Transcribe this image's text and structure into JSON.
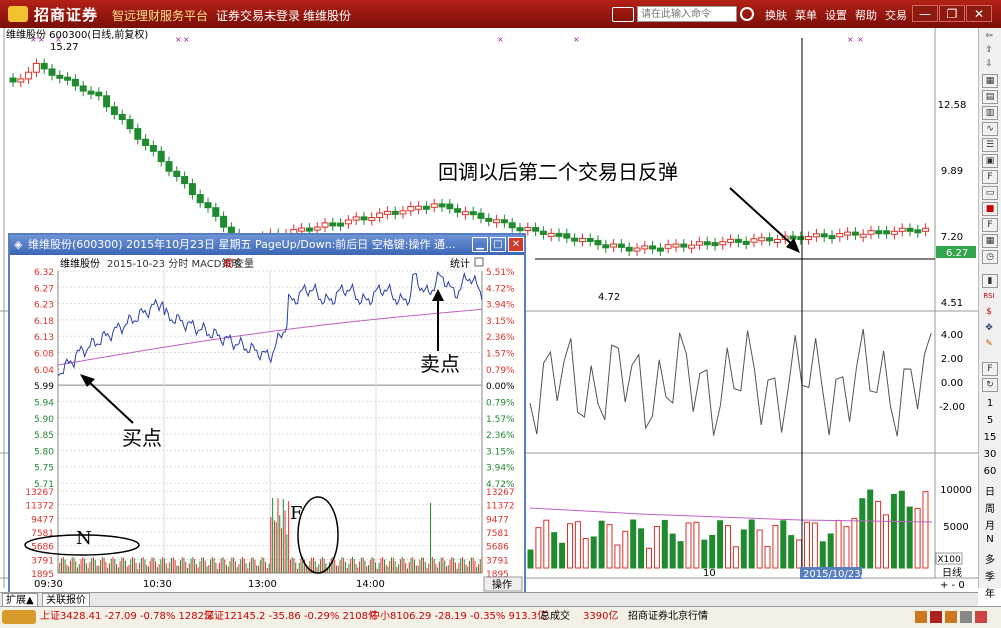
{
  "titlebar": {
    "brand": "招商证券",
    "slogan": "智远理财服务平台",
    "menu": [
      "证券交易未登录",
      "维维股份"
    ],
    "command_placeholder": "请在此输入命令",
    "right_menu": [
      "换肤",
      "菜单",
      "设置",
      "帮助",
      "交易"
    ],
    "window_buttons": [
      "—",
      "❐",
      "✕"
    ]
  },
  "main": {
    "header": "维维股份 600300(日线,前复权)",
    "high_label": "15.27",
    "low_label": "4.72",
    "price_ticks": [
      "12.58",
      "9.89",
      "7.20",
      "4.51"
    ],
    "current_price": "6.27",
    "osc_ticks": [
      "4.00",
      "2.00",
      "0.00",
      "-2.00"
    ],
    "vol_ticks": [
      "10000",
      "5000"
    ],
    "vol_unit": "X100",
    "x_label": "10",
    "date_label": "2015/10/23/五",
    "period_label": "日线",
    "annotation": "回调以后第二个交易日反弹"
  },
  "popup": {
    "title": "维维股份(600300) 2015年10月23日 星期五 PageUp/Down:前后日 空格键:操作 通...",
    "header_stock": "维维股份",
    "header_info": "2015-10-23 分时 MACD策略",
    "header_cheng": "成",
    "header_jiao": "交量",
    "stats_label": "统计",
    "left_ticks": [
      "6.32",
      "6.27",
      "6.23",
      "6.18",
      "6.13",
      "6.08",
      "6.04",
      "5.99",
      "5.94",
      "5.90",
      "5.85",
      "5.80",
      "5.75",
      "5.71"
    ],
    "right_ticks": [
      "5.51%",
      "4.72%",
      "3.94%",
      "3.15%",
      "2.36%",
      "1.57%",
      "0.79%",
      "0.00%",
      "0.79%",
      "1.57%",
      "2.36%",
      "3.15%",
      "3.94%",
      "4.72%"
    ],
    "vol_ticks": [
      "13267",
      "11372",
      "9477",
      "7581",
      "5686",
      "3791",
      "1895"
    ],
    "time_ticks": [
      "09:30",
      "10:30",
      "13:00",
      "14:00"
    ],
    "op_label": "操作",
    "buy_label": "买点",
    "sell_label": "卖点",
    "n_label": "N",
    "f_label": "F"
  },
  "rightbar": {
    "numbers": [
      "1",
      "5",
      "15",
      "30",
      "60"
    ],
    "periods": [
      "日",
      "周",
      "月",
      "N",
      "多",
      "季",
      "年"
    ]
  },
  "bottom_tabs": [
    "扩展▲",
    "关联报价"
  ],
  "status": {
    "sh": "上证3428.41  -27.09  -0.78%  1282亿",
    "sz": "深证12145.2  -35.86  -0.29%  2108亿",
    "zx": "中小8106.29  -28.19  -0.35%  913.3亿",
    "total_label": "总成交",
    "total": "3390亿",
    "broker": "招商证券北京行情"
  },
  "colors": {
    "up": "#e0302a",
    "down": "#1f8a2e",
    "title_bar": "#a31c12",
    "price_line": "#2a3fa8",
    "avg_line": "#c060c0"
  }
}
